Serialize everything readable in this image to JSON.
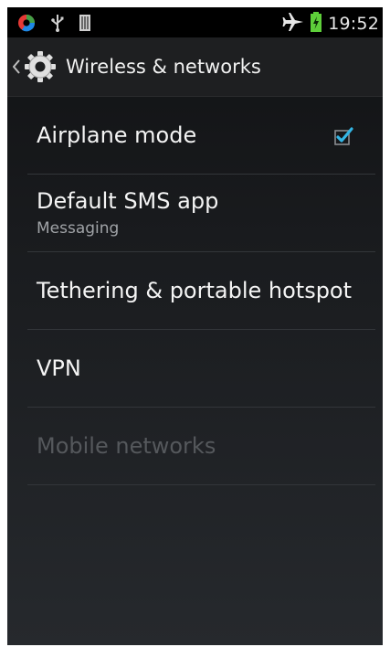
{
  "status_bar": {
    "time": "19:52",
    "icons": [
      "sync-icon",
      "usb-icon",
      "sim-icon",
      "airplane-icon",
      "battery-charging-icon"
    ]
  },
  "action_bar": {
    "title": "Wireless & networks",
    "icon": "gear-icon",
    "up_icon": "chevron-left-icon"
  },
  "preferences": [
    {
      "title": "Airplane mode",
      "checked": true
    },
    {
      "title": "Default SMS app",
      "summary": "Messaging"
    },
    {
      "title": "Tethering & portable hotspot"
    },
    {
      "title": "VPN"
    },
    {
      "title": "Mobile networks",
      "enabled": false
    }
  ],
  "colors": {
    "accent": "#33b5e5",
    "battery": "#5ecf3a"
  }
}
